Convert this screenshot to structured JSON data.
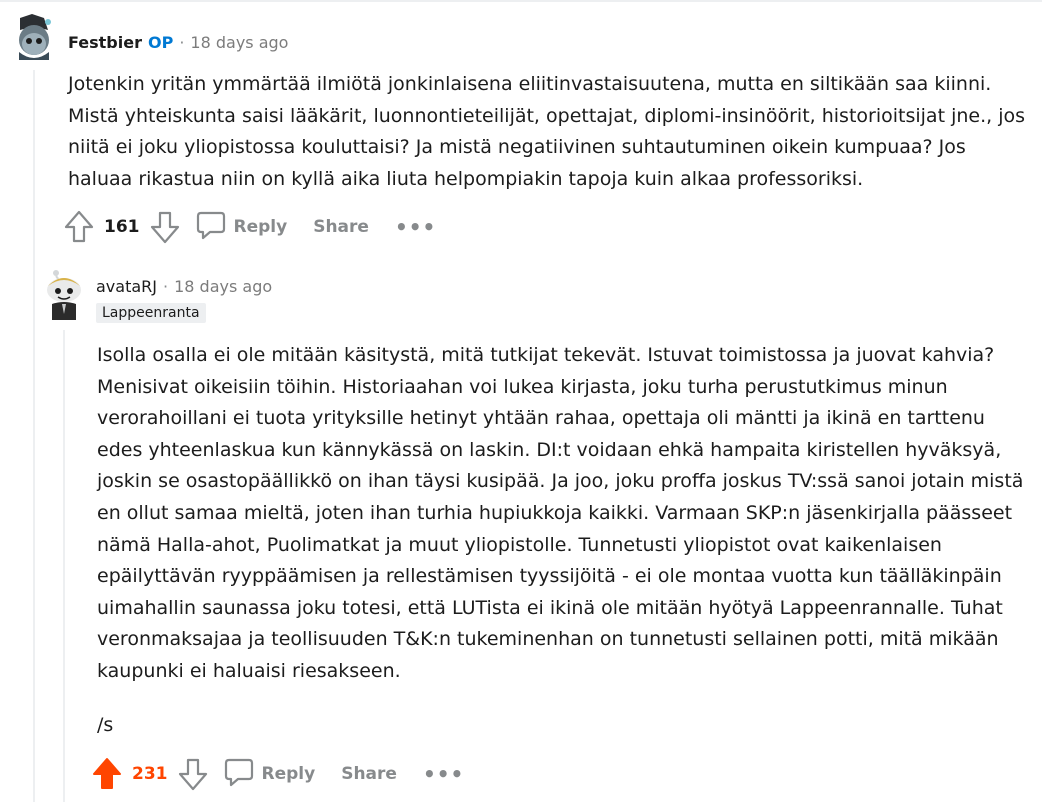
{
  "comments": [
    {
      "author": "Festbier",
      "op_badge": "OP",
      "separator": "·",
      "time": "18 days ago",
      "body": "Jotenkin yritän ymmärtää ilmiötä jonkinlaisena eliitinvastaisuutena, mutta en siltikään saa kiinni. Mistä yhteiskunta saisi lääkärit, luonnontieteilijät, opettajat, diplomi-insinöörit, historioitsijat jne., jos niitä ei joku yliopistossa kouluttaisi? Ja mistä negatiivinen suhtautuminen oikein kumpuaa? Jos haluaa rikastua niin on kyllä aika liuta helpompiakin tapoja kuin alkaa professoriksi.",
      "score": "161",
      "reply_label": "Reply",
      "share_label": "Share",
      "more_label": "•••"
    },
    {
      "author": "avataRJ",
      "separator": "·",
      "time": "18 days ago",
      "flair": "Lappeenranta",
      "body": "Isolla osalla ei ole mitään käsitystä, mitä tutkijat tekevät. Istuvat toimistossa ja juovat kahvia? Menisivat oikeisiin töihin. Historiaahan voi lukea kirjasta, joku turha perustutkimus minun verorahoillani ei tuota yrityksille hetinyt yhtään rahaa, opettaja oli mäntti ja ikinä en tarttenu edes yhteenlaskua kun kännykässä on laskin. DI:t voidaan ehkä hampaita kiristellen hyväksyä, joskin se osastopäällikkö on ihan täysi kusipää. Ja joo, joku proffa joskus TV:ssä sanoi jotain mistä en ollut samaa mieltä, joten ihan turhia hupiukkoja kaikki. Varmaan SKP:n jäsenkirjalla päässeet nämä Halla-ahot, Puolimatkat ja muut yliopistolle. Tunnetusti yliopistot ovat kaikenlaisen epäilyttävän ryyppäämisen ja rellestämisen tyyssijöitä - ei ole montaa vuotta kun täälläkinpäin uimahallin saunassa joku totesi, että LUTista ei ikinä ole mitään hyötyä Lappeenrannalle. Tuhat veronmaksajaa ja teollisuuden T&K:n tukeminenhan on tunnetusti sellainen potti, mitä mikään kaupunki ei haluaisi riesakseen.",
      "signoff": "/s",
      "score": "231",
      "upvoted": true,
      "reply_label": "Reply",
      "share_label": "Share",
      "more_label": "•••"
    }
  ],
  "colors": {
    "op": "#0079d3",
    "upvote": "#ff4500",
    "muted": "#878a8c",
    "thread_line": "#edeff1"
  }
}
